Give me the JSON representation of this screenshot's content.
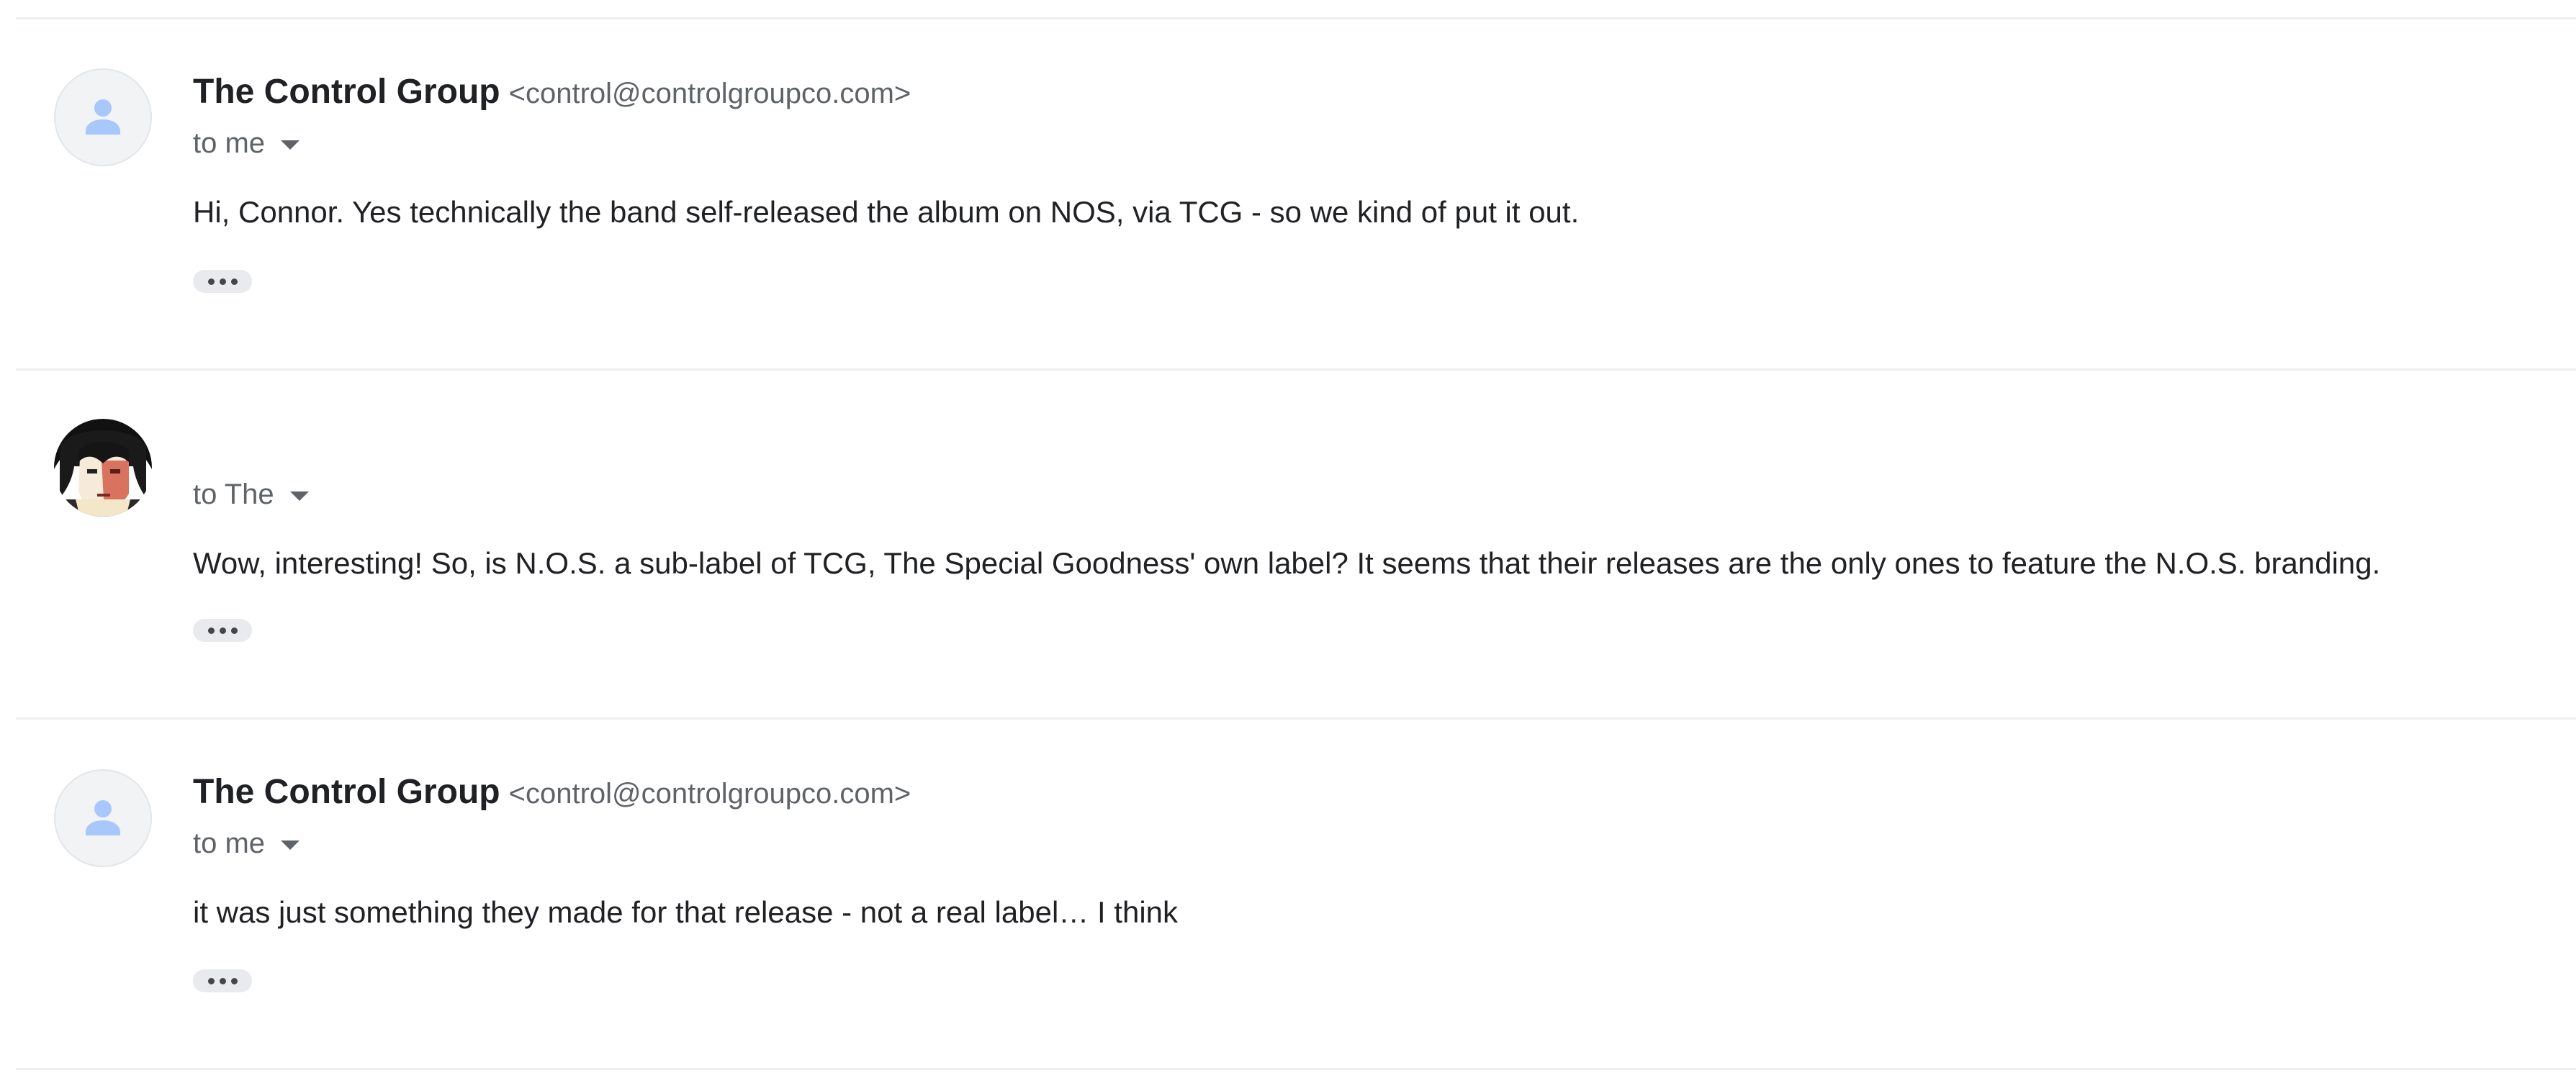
{
  "messages": [
    {
      "sender_name": "The Control Group",
      "sender_email": "<control@controlgroupco.com>",
      "recipient": "to me",
      "body": "Hi, Connor. Yes technically the band self-released the album on NOS, via TCG - so we kind of put it out.",
      "avatar": "person-icon"
    },
    {
      "sender_name": "",
      "sender_email": "",
      "recipient": "to The",
      "body": "Wow, interesting! So, is N.O.S. a sub-label of TCG, The Special Goodness' own label? It seems that their releases are the only ones to feature the N.O.S. branding.",
      "avatar": "profile-photo"
    },
    {
      "sender_name": "The Control Group",
      "sender_email": "<control@controlgroupco.com>",
      "recipient": "to me",
      "body": "it was just something they made for that release - not a real label… I think",
      "avatar": "person-icon"
    }
  ],
  "icons": {
    "expand_caret": "caret-down-icon",
    "show_trimmed": "more-horiz-icon"
  },
  "colors": {
    "default_avatar_bg": "#f1f3f4",
    "default_avatar_glyph": "#a8c7fa",
    "secondary_text": "#5f6368",
    "divider": "#eceff1"
  }
}
